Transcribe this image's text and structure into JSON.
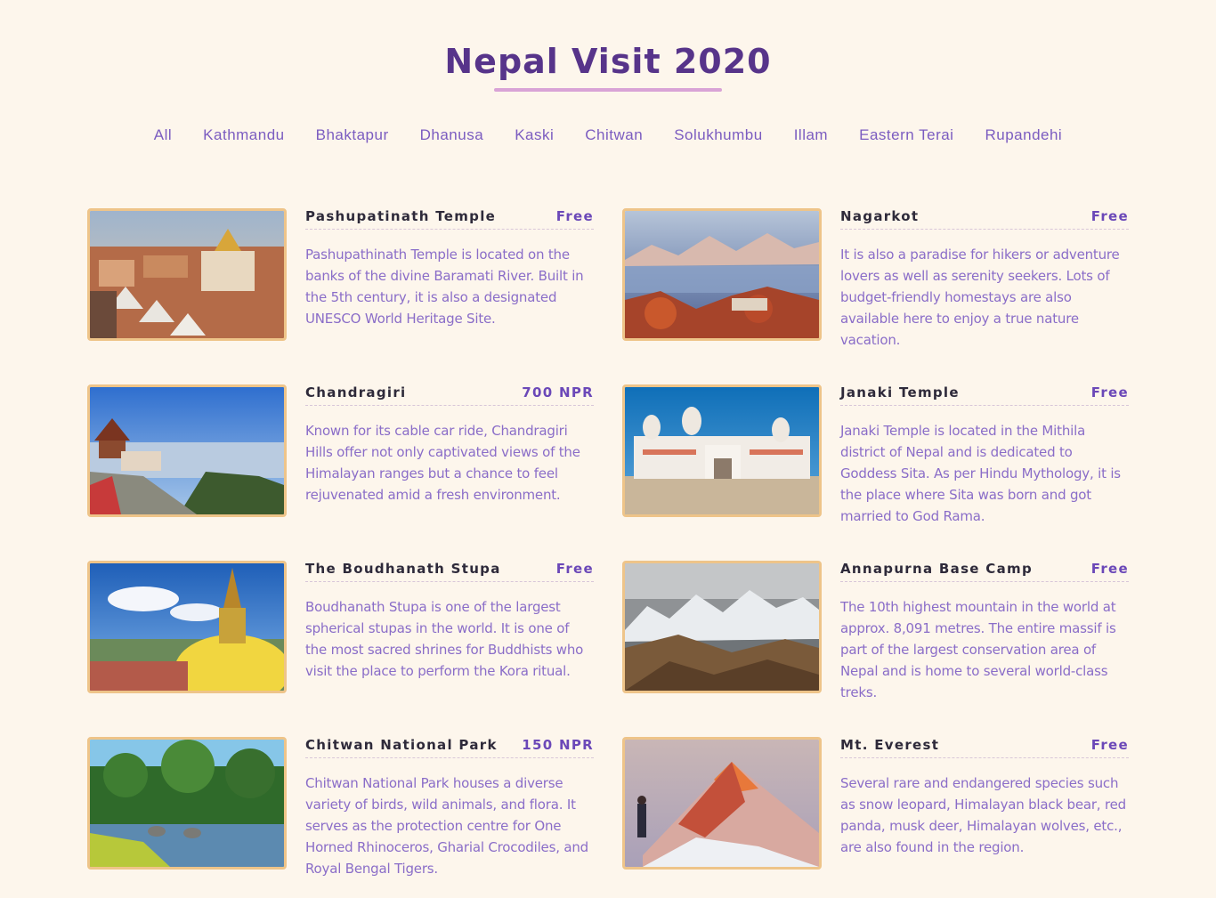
{
  "header": {
    "title": "Nepal Visit 2020"
  },
  "filters": [
    "All",
    "Kathmandu",
    "Bhaktapur",
    "Dhanusa",
    "Kaski",
    "Chitwan",
    "Solukhumbu",
    "Illam",
    "Eastern Terai",
    "Rupandehi"
  ],
  "items": [
    {
      "name": "Pashupatinath Temple",
      "price": "Free",
      "desc": "Pashupathinath Temple is located on the banks of the divine Baramati River. Built in the 5th century, it is also a designated UNESCO World Heritage Site.",
      "image": "temple-city-image"
    },
    {
      "name": "Nagarkot",
      "price": "Free",
      "desc": "It is also a paradise for hikers or adventure lovers as well as serenity seekers. Lots of budget-friendly homestays are also available here to enjoy a true nature vacation.",
      "image": "mountain-sunrise-image"
    },
    {
      "name": "Chandragiri",
      "price": "700 NPR",
      "desc": "Known for its cable car ride, Chandragiri Hills offer not only captivated views of the Himalayan ranges but a chance to feel rejuvenated amid a fresh environment.",
      "image": "hilltop-temple-image"
    },
    {
      "name": "Janaki Temple",
      "price": "Free",
      "desc": "Janaki Temple is located in the Mithila district of Nepal and is dedicated to Goddess Sita. As per Hindu Mythology, it is the place where Sita was born and got married to God Rama.",
      "image": "white-palace-image"
    },
    {
      "name": "The Boudhanath Stupa",
      "price": "Free",
      "desc": "Boudhanath Stupa is one of the largest spherical stupas in the world. It is one of the most sacred shrines for Buddhists who visit the place to perform the Kora ritual.",
      "image": "stupa-image"
    },
    {
      "name": "Annapurna Base Camp",
      "price": "Free",
      "desc": "The 10th highest mountain in the world at approx. 8,091 metres. The entire massif is part of the largest conservation area of Nepal and is home to several world-class treks.",
      "image": "snow-range-image"
    },
    {
      "name": "Chitwan National Park",
      "price": "150 NPR",
      "desc": "Chitwan National Park houses a diverse variety of birds, wild animals, and flora. It serves as the protection centre for One Horned Rhinoceros, Gharial Crocodiles, and Royal Bengal Tigers.",
      "image": "jungle-river-image"
    },
    {
      "name": "Mt. Everest",
      "price": "Free",
      "desc": "Several rare and endangered species such as snow leopard, Himalayan black bear, red panda, musk deer, Himalayan wolves, etc., are also found in the region.",
      "image": "everest-peak-image"
    }
  ]
}
